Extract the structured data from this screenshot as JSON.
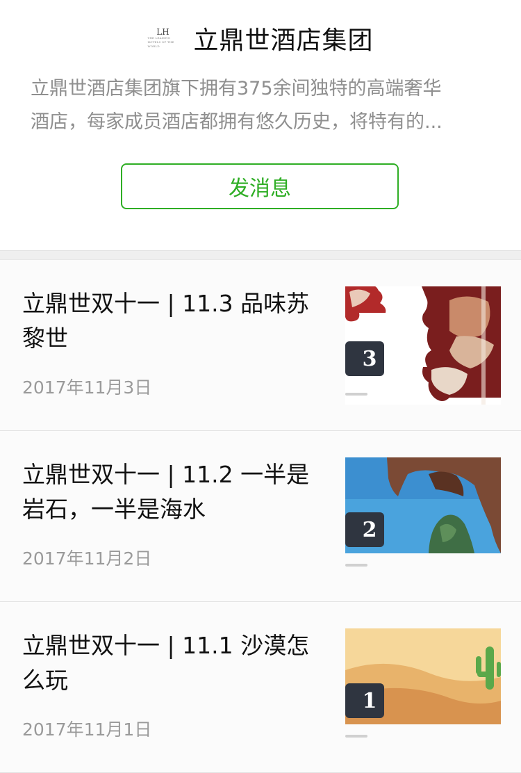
{
  "account": {
    "logo_text": "LH",
    "logo_small_text": "THE LEADING HOTELS OF THE WORLD",
    "name": "立鼎世酒店集团",
    "description_line1": "立鼎世酒店集团旗下拥有375余间独特的高端奢华",
    "description_line2": "酒店，每家成员酒店都拥有悠久历史，将特有的...",
    "message_button": "发消息"
  },
  "articles": [
    {
      "title": "立鼎世双十一 | 11.3 品味苏黎世",
      "date": "2017年11月3日",
      "badge": "3",
      "thumb_icon": "puzzle-food-image"
    },
    {
      "title": "立鼎世双十一 | 11.2 一半是岩石，一半是海水",
      "date": "2017年11月2日",
      "badge": "2",
      "thumb_icon": "sea-rock-image"
    },
    {
      "title": "立鼎世双十一 | 11.1 沙漠怎么玩",
      "date": "2017年11月1日",
      "badge": "1",
      "thumb_icon": "desert-cactus-image"
    }
  ],
  "colors": {
    "accent_green": "#2fae25",
    "text_gray": "#8f8f8f",
    "date_gray": "#9a9a9a"
  }
}
